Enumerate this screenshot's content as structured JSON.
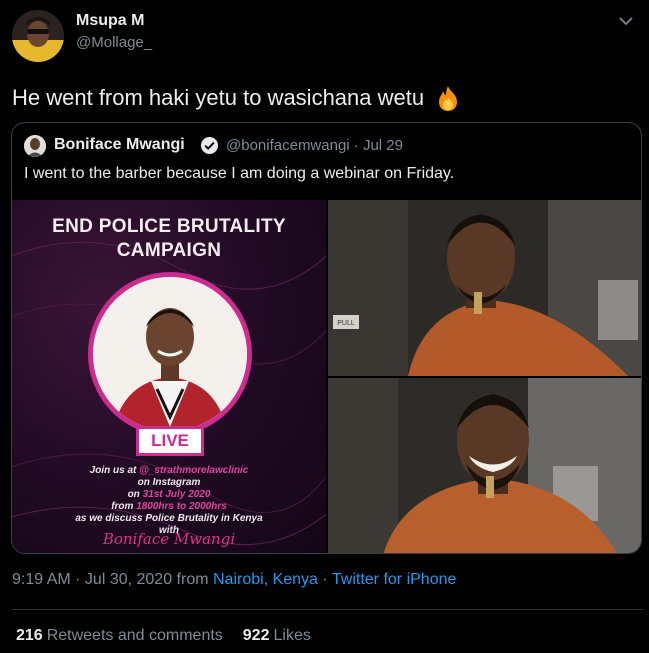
{
  "tweet": {
    "author_name": "Msupa M",
    "author_handle": "@Mollage_",
    "text": "He went from haki yetu to wasichana wetu",
    "emoji": "fire-icon",
    "meta": {
      "time": "9:19 AM · Jul 30, 2020 from ",
      "location": "Nairobi, Kenya",
      "separator": " · ",
      "client": "Twitter for iPhone"
    },
    "stats": {
      "retweets_count": "216",
      "retweets_label": "Retweets and comments",
      "likes_count": "922",
      "likes_label": "Likes"
    }
  },
  "quote": {
    "author_name": "Boniface Mwangi",
    "author_handle": "@bonifacemwangi · Jul 29",
    "text": "I went to the barber because I am doing a webinar on Friday.",
    "poster": {
      "title_line1": "END POLICE BRUTALITY",
      "title_line2": "CAMPAIGN",
      "live_label": "LIVE",
      "line1_prefix": "Join us at ",
      "line1_account": "@_strathmorelawclinic",
      "line2": "on Instagram",
      "line3_prefix": "on ",
      "line3_date": "31st July 2020",
      "line4_prefix": "from ",
      "line4_time": "1800hrs to 2000hrs",
      "line5": "as we discuss Police Brutality in Kenya",
      "line6": "with",
      "signature": "Boniface Mwangi"
    },
    "photo_sign": "PULL"
  },
  "colors": {
    "background": "#000000",
    "link": "#1d9bf0",
    "muted": "#7f8b96",
    "accent_pink": "#cc2b8f"
  }
}
